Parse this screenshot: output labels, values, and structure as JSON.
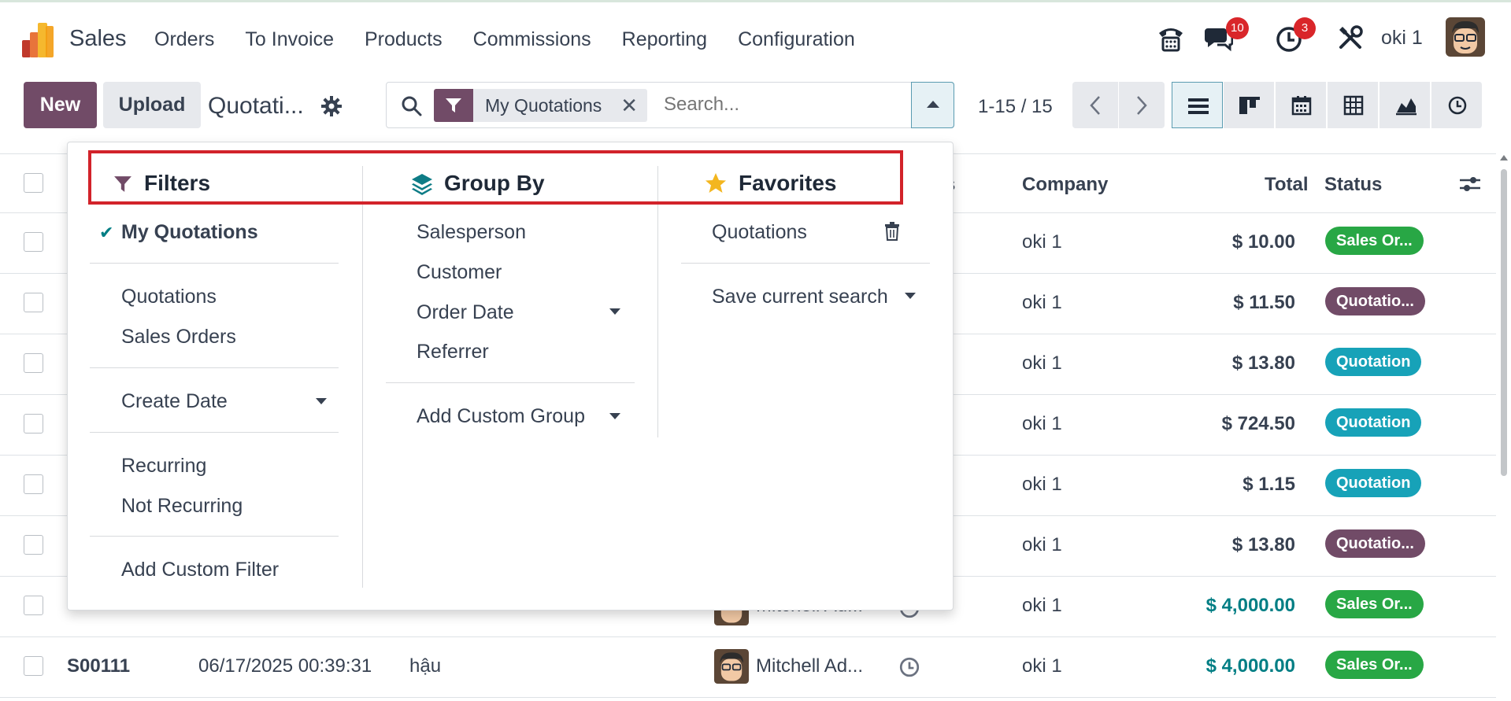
{
  "app": {
    "name": "Sales"
  },
  "menu": [
    "Orders",
    "To Invoice",
    "Products",
    "Commissions",
    "Reporting",
    "Configuration"
  ],
  "systray": {
    "phone_icon": "phone-icon",
    "messages_count": "10",
    "activities_count": "3",
    "user_name": "oki 1"
  },
  "control": {
    "new_label": "New",
    "upload_label": "Upload",
    "breadcrumb": "Quotati...",
    "facet_label": "My Quotations",
    "search_placeholder": "Search...",
    "pager": "1-15 / 15"
  },
  "list": {
    "headers": {
      "company": "Company",
      "total": "Total",
      "status": "Status",
      "partial_ies": "ies"
    },
    "rows": [
      {
        "company": "oki 1",
        "total": "$ 10.00",
        "status": "Sales Or...",
        "status_color": "#28a745"
      },
      {
        "company": "oki 1",
        "total": "$ 11.50",
        "status": "Quotatio...",
        "status_color": "#714b67"
      },
      {
        "company": "oki 1",
        "total": "$ 13.80",
        "status": "Quotation",
        "status_color": "#17a2b8"
      },
      {
        "company": "oki 1",
        "total": "$ 724.50",
        "status": "Quotation",
        "status_color": "#17a2b8"
      },
      {
        "company": "oki 1",
        "total": "$ 1.15",
        "status": "Quotation",
        "status_color": "#17a2b8"
      },
      {
        "company": "oki 1",
        "total": "$ 13.80",
        "status": "Quotatio...",
        "status_color": "#714b67"
      },
      {
        "salesperson": "Mitchell Ad...",
        "company": "oki 1",
        "total": "$ 4,000.00",
        "status": "Sales Or...",
        "status_color": "#28a745"
      },
      {
        "number": "S00111",
        "date": "06/17/2025 00:39:31",
        "customer": "hậu",
        "salesperson": "Mitchell Ad...",
        "company": "oki 1",
        "total": "$ 4,000.00",
        "status": "Sales Or...",
        "status_color": "#28a745"
      }
    ]
  },
  "dropdown": {
    "filters": {
      "title": "Filters",
      "my_quotations": "My Quotations",
      "quotations": "Quotations",
      "sales_orders": "Sales Orders",
      "create_date": "Create Date",
      "recurring": "Recurring",
      "not_recurring": "Not Recurring",
      "add_custom_filter": "Add Custom Filter"
    },
    "group_by": {
      "title": "Group By",
      "salesperson": "Salesperson",
      "customer": "Customer",
      "order_date": "Order Date",
      "referrer": "Referrer",
      "add_custom_group": "Add Custom Group"
    },
    "favorites": {
      "title": "Favorites",
      "quotations": "Quotations",
      "save_current_search": "Save current search"
    }
  },
  "colors": {
    "brand": "#714b67",
    "link": "#017e84",
    "highlight": "#d2232a"
  }
}
